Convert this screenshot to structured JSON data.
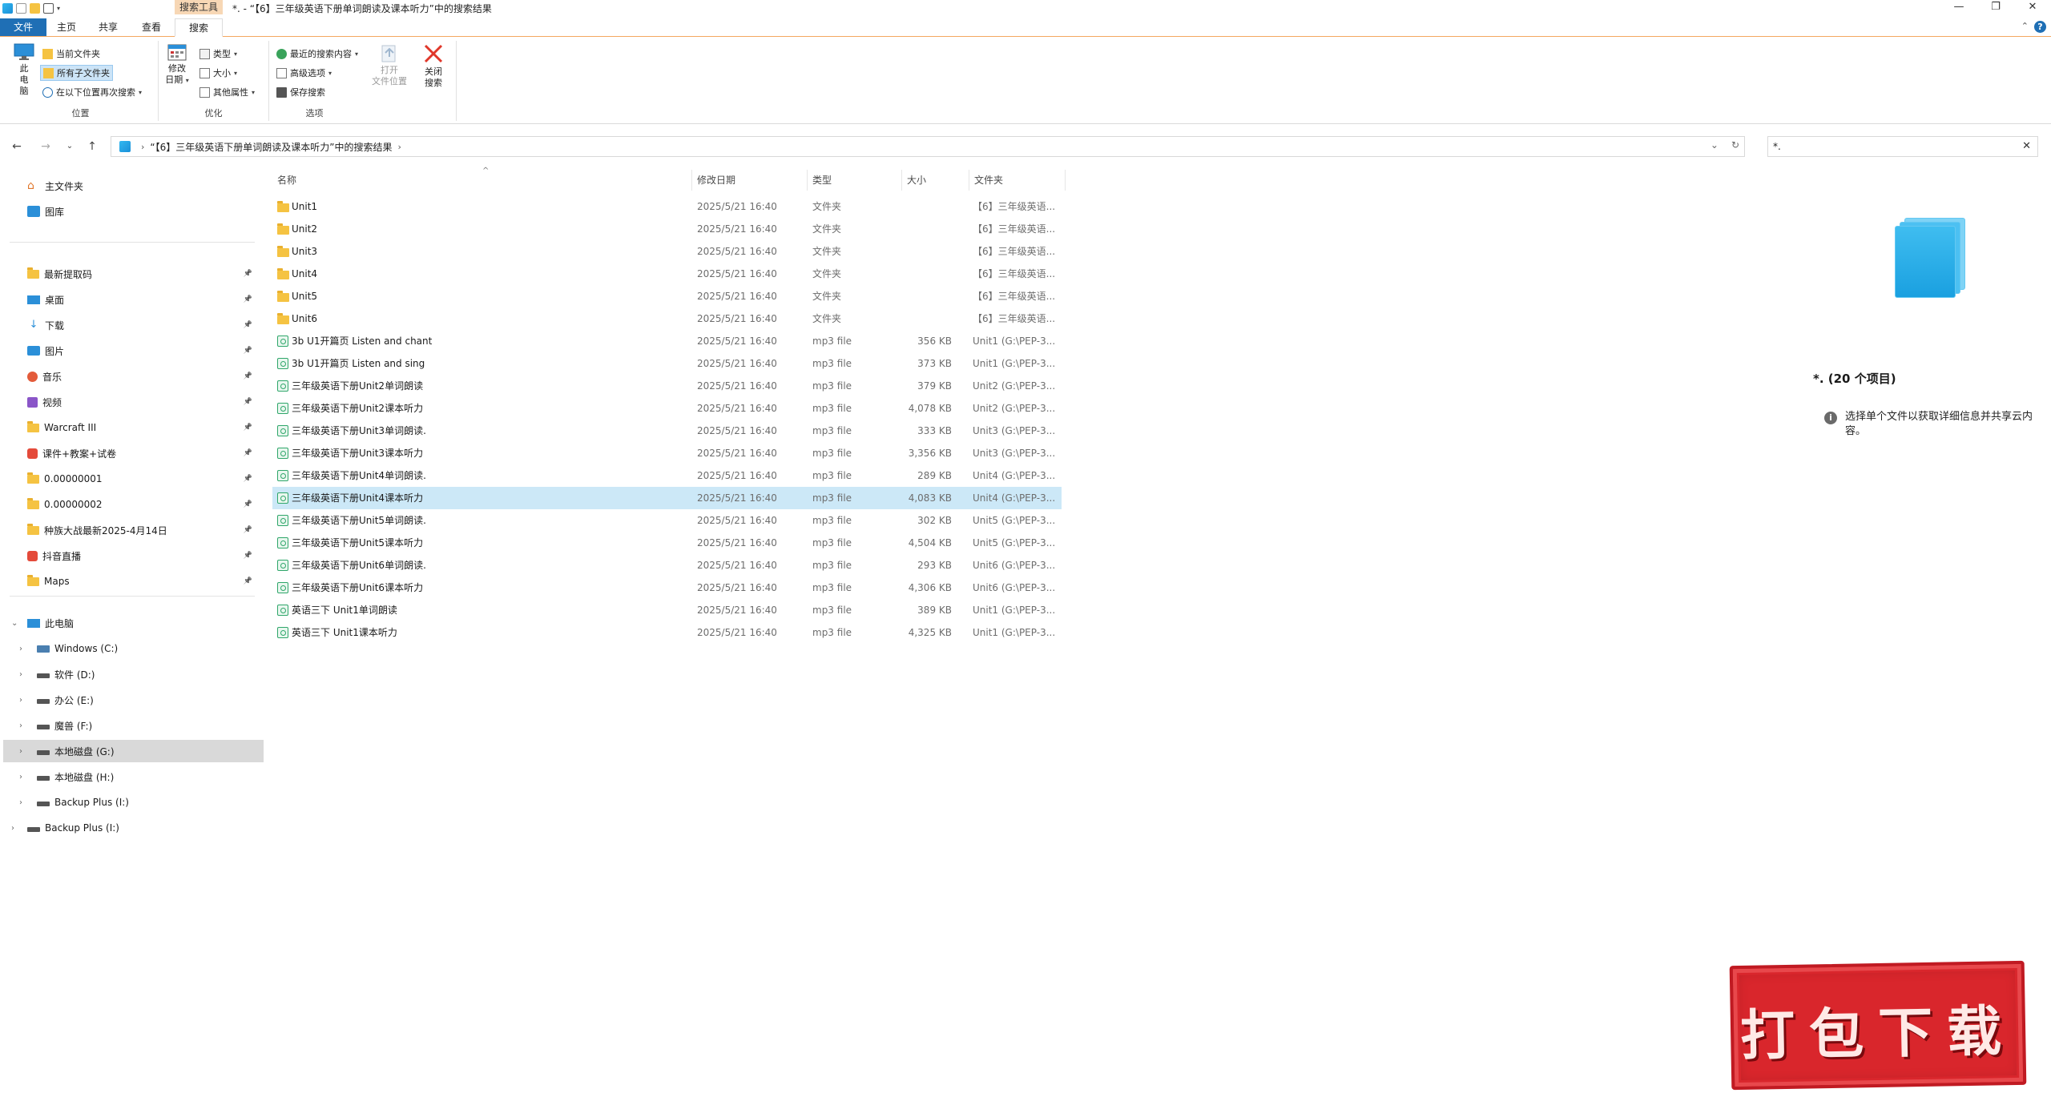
{
  "window": {
    "title": "*. - “【6】三年级英语下册单词朗读及课本听力”中的搜索结果",
    "context_tab": "搜索工具",
    "controls": {
      "minimize": "—",
      "maximize": "❐",
      "close": "✕"
    }
  },
  "ribbon_tabs": [
    {
      "label": "文件"
    },
    {
      "label": "主页"
    },
    {
      "label": "共享"
    },
    {
      "label": "查看"
    },
    {
      "label": "搜索"
    }
  ],
  "ribbon": {
    "location": {
      "label": "位置",
      "this_pc": "此电脑",
      "current_folder": "当前文件夹",
      "all_subfolders": "所有子文件夹",
      "search_again": "在以下位置再次搜索"
    },
    "refine": {
      "label": "优化",
      "date_modified_1": "修改",
      "date_modified_2": "日期",
      "kind": "类型",
      "size": "大小",
      "other_props": "其他属性"
    },
    "options": {
      "label": "选项",
      "recent": "最近的搜索内容",
      "advanced": "高级选项",
      "save": "保存搜索",
      "open_location_1": "打开",
      "open_location_2": "文件位置",
      "close_search_1": "关闭",
      "close_search_2": "搜索"
    }
  },
  "address": {
    "path": "“【6】三年级英语下册单词朗读及课本听力”中的搜索结果",
    "search_value": "*."
  },
  "nav": {
    "quick": [
      {
        "label": "主文件夹",
        "icon": "home-icon"
      },
      {
        "label": "图库",
        "icon": "gallery-icon"
      }
    ],
    "pinned": [
      {
        "label": "最新提取码",
        "icon": "folder-icon"
      },
      {
        "label": "桌面",
        "icon": "desktop-icon"
      },
      {
        "label": "下载",
        "icon": "download-icon"
      },
      {
        "label": "图片",
        "icon": "pictures-icon"
      },
      {
        "label": "音乐",
        "icon": "music-icon"
      },
      {
        "label": "视频",
        "icon": "videos-icon"
      },
      {
        "label": "Warcraft III",
        "icon": "folder-icon"
      },
      {
        "label": "课件+教案+试卷",
        "icon": "app-icon"
      },
      {
        "label": "0.00000001",
        "icon": "folder-icon"
      },
      {
        "label": "0.00000002",
        "icon": "folder-icon"
      },
      {
        "label": "种族大战最新2025-4月14日",
        "icon": "folder-icon"
      },
      {
        "label": "抖音直播",
        "icon": "app-icon"
      },
      {
        "label": "Maps",
        "icon": "folder-icon"
      }
    ],
    "this_pc": "此电脑",
    "drives": [
      {
        "label": "Windows (C:)"
      },
      {
        "label": "软件 (D:)"
      },
      {
        "label": "办公 (E:)"
      },
      {
        "label": "魔兽 (F:)"
      },
      {
        "label": "本地磁盘 (G:)"
      },
      {
        "label": "本地磁盘 (H:)"
      },
      {
        "label": "Backup Plus (I:)"
      }
    ],
    "external": "Backup Plus (I:)"
  },
  "columns": {
    "name": "名称",
    "date": "修改日期",
    "type": "类型",
    "size": "大小",
    "folder": "文件夹"
  },
  "files": [
    {
      "name": "Unit1",
      "date": "2025/5/21 16:40",
      "type": "文件夹",
      "size": "",
      "folder": "【6】三年级英语...",
      "kind": "folder"
    },
    {
      "name": "Unit2",
      "date": "2025/5/21 16:40",
      "type": "文件夹",
      "size": "",
      "folder": "【6】三年级英语...",
      "kind": "folder"
    },
    {
      "name": "Unit3",
      "date": "2025/5/21 16:40",
      "type": "文件夹",
      "size": "",
      "folder": "【6】三年级英语...",
      "kind": "folder"
    },
    {
      "name": "Unit4",
      "date": "2025/5/21 16:40",
      "type": "文件夹",
      "size": "",
      "folder": "【6】三年级英语...",
      "kind": "folder"
    },
    {
      "name": "Unit5",
      "date": "2025/5/21 16:40",
      "type": "文件夹",
      "size": "",
      "folder": "【6】三年级英语...",
      "kind": "folder"
    },
    {
      "name": "Unit6",
      "date": "2025/5/21 16:40",
      "type": "文件夹",
      "size": "",
      "folder": "【6】三年级英语...",
      "kind": "folder"
    },
    {
      "name": "3b U1开篇页 Listen and chant",
      "date": "2025/5/21 16:40",
      "type": "mp3 file",
      "size": "356 KB",
      "folder": "Unit1 (G:\\PEP-3...",
      "kind": "mp3"
    },
    {
      "name": "3b U1开篇页 Listen and sing",
      "date": "2025/5/21 16:40",
      "type": "mp3 file",
      "size": "373 KB",
      "folder": "Unit1 (G:\\PEP-3...",
      "kind": "mp3"
    },
    {
      "name": "三年级英语下册Unit2单词朗读",
      "date": "2025/5/21 16:40",
      "type": "mp3 file",
      "size": "379 KB",
      "folder": "Unit2 (G:\\PEP-3...",
      "kind": "mp3"
    },
    {
      "name": "三年级英语下册Unit2课本听力",
      "date": "2025/5/21 16:40",
      "type": "mp3 file",
      "size": "4,078 KB",
      "folder": "Unit2 (G:\\PEP-3...",
      "kind": "mp3"
    },
    {
      "name": "三年级英语下册Unit3单词朗读.",
      "date": "2025/5/21 16:40",
      "type": "mp3 file",
      "size": "333 KB",
      "folder": "Unit3 (G:\\PEP-3...",
      "kind": "mp3"
    },
    {
      "name": "三年级英语下册Unit3课本听力",
      "date": "2025/5/21 16:40",
      "type": "mp3 file",
      "size": "3,356 KB",
      "folder": "Unit3 (G:\\PEP-3...",
      "kind": "mp3"
    },
    {
      "name": "三年级英语下册Unit4单词朗读.",
      "date": "2025/5/21 16:40",
      "type": "mp3 file",
      "size": "289 KB",
      "folder": "Unit4 (G:\\PEP-3...",
      "kind": "mp3"
    },
    {
      "name": "三年级英语下册Unit4课本听力",
      "date": "2025/5/21 16:40",
      "type": "mp3 file",
      "size": "4,083 KB",
      "folder": "Unit4 (G:\\PEP-3...",
      "kind": "mp3",
      "selected": true
    },
    {
      "name": "三年级英语下册Unit5单词朗读.",
      "date": "2025/5/21 16:40",
      "type": "mp3 file",
      "size": "302 KB",
      "folder": "Unit5 (G:\\PEP-3...",
      "kind": "mp3"
    },
    {
      "name": "三年级英语下册Unit5课本听力",
      "date": "2025/5/21 16:40",
      "type": "mp3 file",
      "size": "4,504 KB",
      "folder": "Unit5 (G:\\PEP-3...",
      "kind": "mp3"
    },
    {
      "name": "三年级英语下册Unit6单词朗读.",
      "date": "2025/5/21 16:40",
      "type": "mp3 file",
      "size": "293 KB",
      "folder": "Unit6 (G:\\PEP-3...",
      "kind": "mp3"
    },
    {
      "name": "三年级英语下册Unit6课本听力",
      "date": "2025/5/21 16:40",
      "type": "mp3 file",
      "size": "4,306 KB",
      "folder": "Unit6 (G:\\PEP-3...",
      "kind": "mp3"
    },
    {
      "name": "英语三下 Unit1单词朗读",
      "date": "2025/5/21 16:40",
      "type": "mp3 file",
      "size": "389 KB",
      "folder": "Unit1 (G:\\PEP-3...",
      "kind": "mp3"
    },
    {
      "name": "英语三下 Unit1课本听力",
      "date": "2025/5/21 16:40",
      "type": "mp3 file",
      "size": "4,325 KB",
      "folder": "Unit1 (G:\\PEP-3...",
      "kind": "mp3"
    }
  ],
  "details": {
    "title": "*. (20 个项目)",
    "info": "选择单个文件以获取详细信息并共享云内容。"
  },
  "stamp": {
    "text": "打包下载"
  },
  "colors": {
    "accent": "#1f6fb5",
    "selection": "#cce8f7",
    "folder": "#f5c342",
    "mp3": "#2fa66a",
    "stamp": "#d9262c"
  }
}
